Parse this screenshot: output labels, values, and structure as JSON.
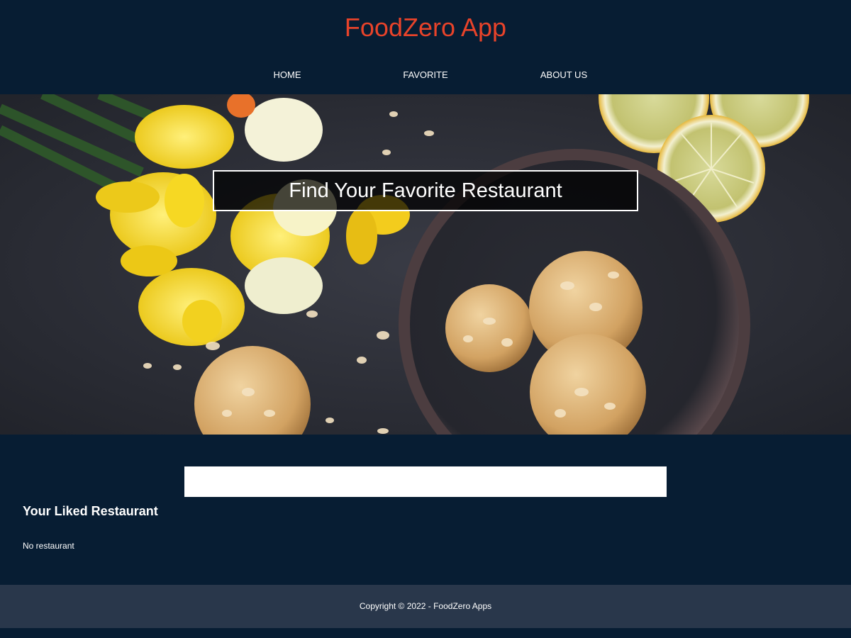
{
  "app": {
    "title": "FoodZero App",
    "title_color": "#e8432a",
    "background_color": "#071d33"
  },
  "nav": {
    "items": [
      {
        "label": "HOME"
      },
      {
        "label": "FAVORITE"
      },
      {
        "label": "ABOUT US"
      }
    ]
  },
  "hero": {
    "heading": "Find Your Favorite Restaurant",
    "image_content": "daffodils, lemon slices, almond cookies in a bowl"
  },
  "search": {
    "value": "",
    "placeholder": ""
  },
  "favorites": {
    "title": "Your Liked Restaurant",
    "empty_message": "No restaurant"
  },
  "footer": {
    "copyright": "Copyright © 2022 - FoodZero Apps",
    "background_color": "#29374b"
  }
}
